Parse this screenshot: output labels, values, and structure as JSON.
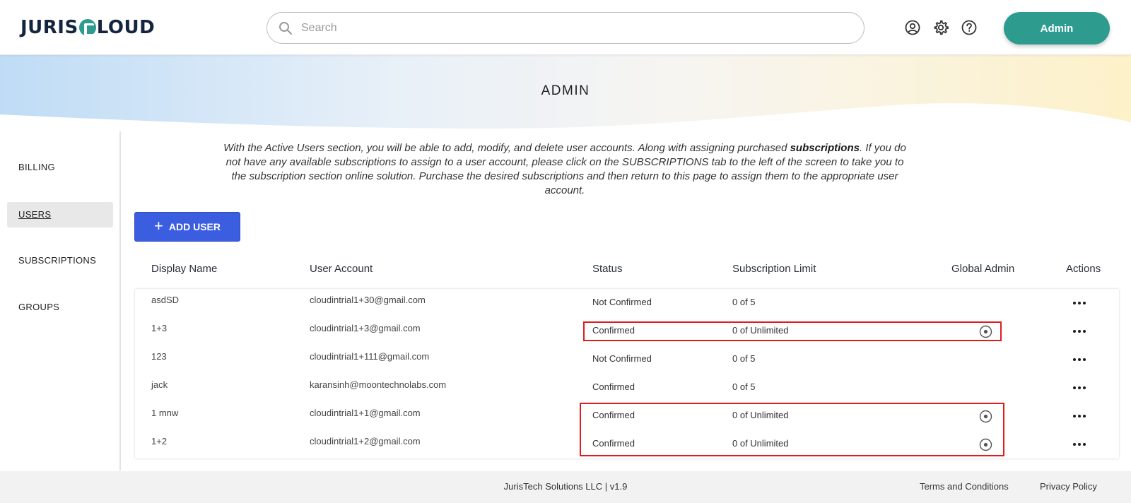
{
  "header": {
    "logo_left": "JURIS",
    "logo_right": "LOUD",
    "search_placeholder": "Search",
    "admin_button": "Admin",
    "icons": [
      "user-circle-icon",
      "gear-icon",
      "help-circle-icon"
    ]
  },
  "banner": {
    "title": "ADMIN"
  },
  "sidebar": {
    "items": [
      {
        "label": "BILLING",
        "active": false
      },
      {
        "label": "USERS",
        "active": true
      },
      {
        "label": "SUBSCRIPTIONS",
        "active": false
      },
      {
        "label": "GROUPS",
        "active": false
      }
    ]
  },
  "intro": {
    "part1": "With the Active Users section, you will be able to add, modify, and delete user accounts. Along with assigning purchased ",
    "bold": "subscriptions",
    "part2": ". If you do not have any available subscriptions to assign to a user account, please click on the SUBSCRIPTIONS tab to the left of the screen to take you to the subscription section online solution. Purchase the desired subscriptions and then return to this page to assign them to the appropriate user account."
  },
  "add_user_button": "ADD USER",
  "table": {
    "columns": {
      "display_name": "Display Name",
      "user_account": "User Account",
      "status": "Status",
      "subscription_limit": "Subscription Limit",
      "global_admin": "Global Admin",
      "actions": "Actions"
    },
    "rows": [
      {
        "name": "asdSD",
        "account": "cloudintrial1+30@gmail.com",
        "status": "Not Confirmed",
        "limit": "0 of 5",
        "global_admin": false
      },
      {
        "name": "1+3",
        "account": "cloudintrial1+3@gmail.com",
        "status": "Confirmed",
        "limit": "0 of Unlimited",
        "global_admin": true
      },
      {
        "name": "123",
        "account": "cloudintrial1+111@gmail.com",
        "status": "Not Confirmed",
        "limit": "0 of 5",
        "global_admin": false
      },
      {
        "name": "jack",
        "account": "karansinh@moontechnolabs.com",
        "status": "Confirmed",
        "limit": "0 of 5",
        "global_admin": false
      },
      {
        "name": "1 mnw",
        "account": "cloudintrial1+1@gmail.com",
        "status": "Confirmed",
        "limit": "0 of Unlimited",
        "global_admin": true
      },
      {
        "name": "1+2",
        "account": "cloudintrial1+2@gmail.com",
        "status": "Confirmed",
        "limit": "0 of Unlimited",
        "global_admin": true
      }
    ]
  },
  "footer": {
    "version": "JurisTech Solutions LLC | v1.9",
    "terms": "Terms and Conditions",
    "privacy": "Privacy Policy"
  },
  "colors": {
    "brand_teal": "#2e9b8f",
    "primary_blue": "#3b5de0",
    "highlight_red": "#e01c1c",
    "logo_navy": "#142540"
  }
}
